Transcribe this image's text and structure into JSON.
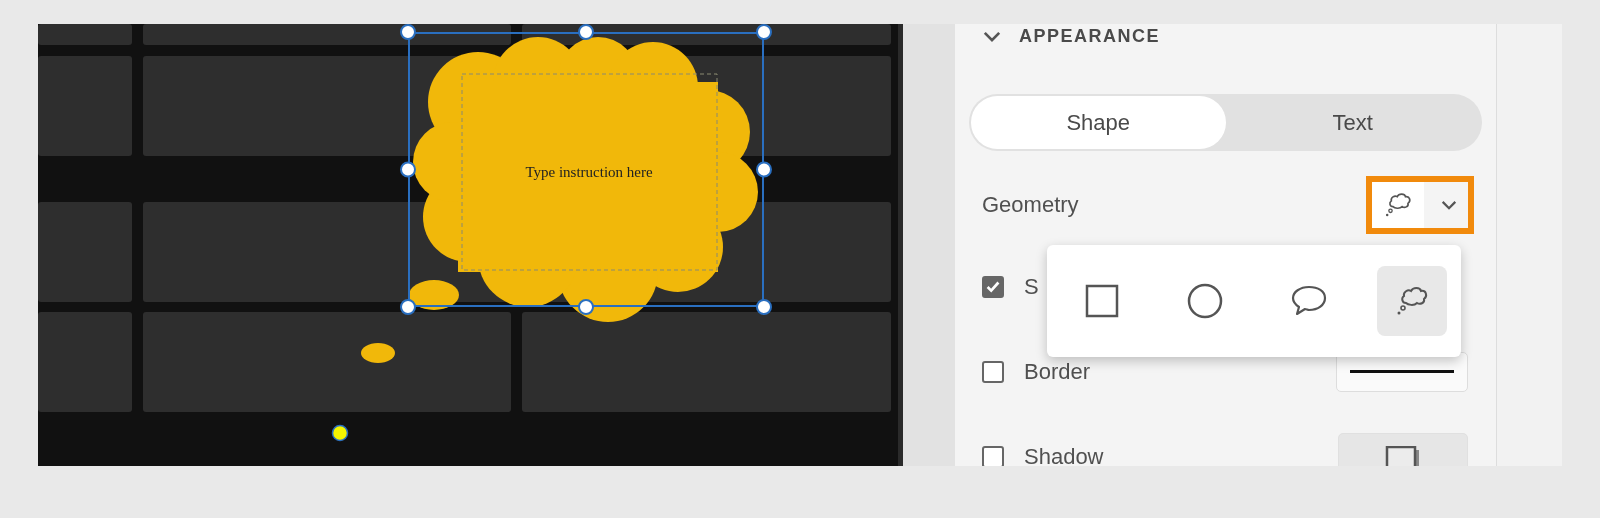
{
  "canvas": {
    "annotation": {
      "kind": "thought-bubble",
      "text": "Type instruction here",
      "selected": true
    }
  },
  "panel": {
    "section": {
      "title": "APPEARANCE",
      "expanded": true
    },
    "tabs": [
      {
        "label": "Shape",
        "selected": true
      },
      {
        "label": "Text",
        "selected": false
      }
    ],
    "geometry": {
      "label": "Geometry",
      "open": true,
      "options": [
        {
          "kind": "square",
          "selected": false
        },
        {
          "kind": "circle",
          "selected": false
        },
        {
          "kind": "speech",
          "selected": false
        },
        {
          "kind": "thought",
          "selected": true
        }
      ]
    },
    "rows": [
      {
        "label": "S",
        "checked": true,
        "kind": "none"
      },
      {
        "label": "Border",
        "checked": false,
        "kind": "line"
      },
      {
        "label": "Shadow",
        "checked": false,
        "kind": "shadow"
      }
    ]
  }
}
